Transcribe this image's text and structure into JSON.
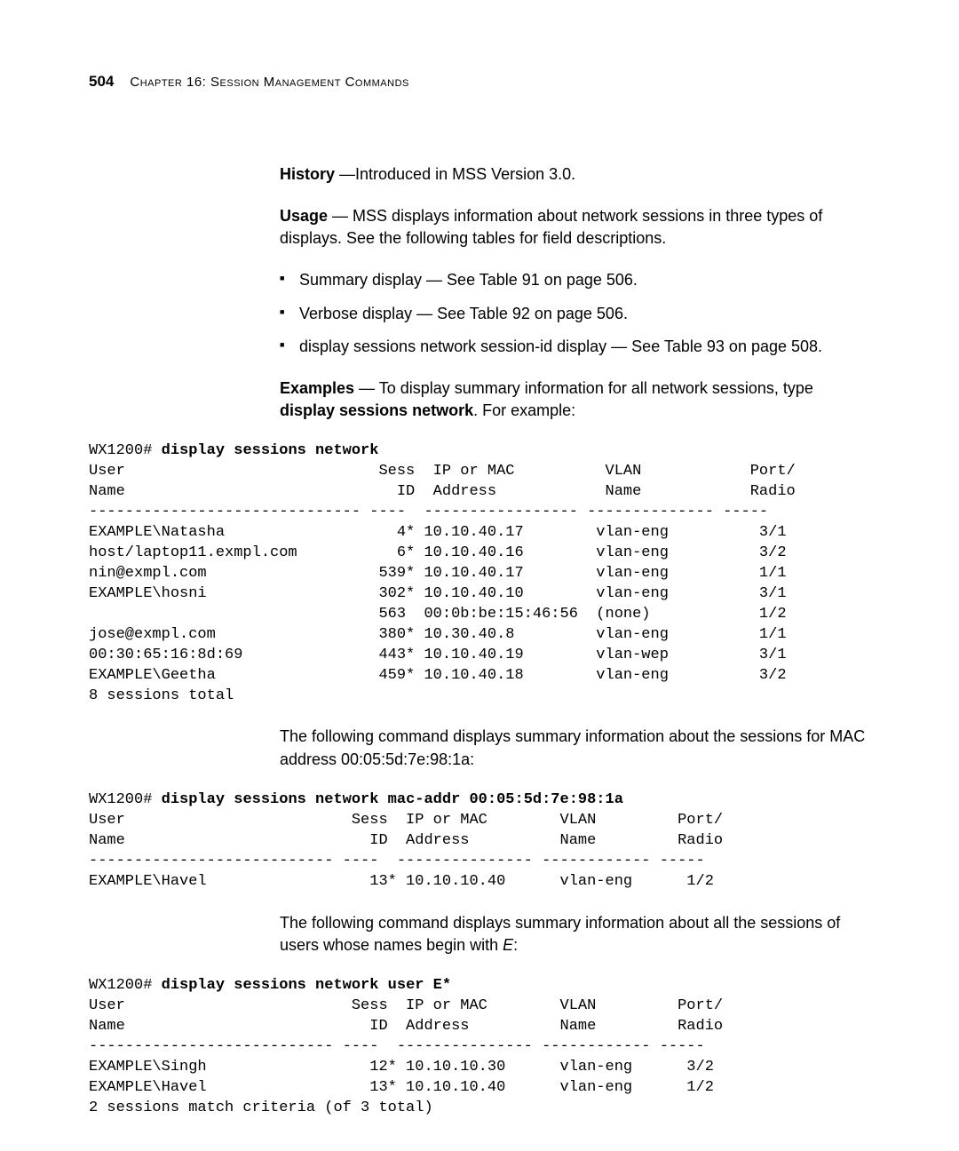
{
  "header": {
    "page_number": "504",
    "chapter_label": "Chapter 16: Session Management Commands"
  },
  "history": {
    "lead": "History",
    "text": " —Introduced in MSS Version 3.0."
  },
  "usage": {
    "lead": "Usage",
    "text": " — MSS displays information about network sessions in three types of displays. See the following tables for field descriptions."
  },
  "bullets": [
    {
      "bold": "Summary display",
      "rest": " — See Table 91 on page 506."
    },
    {
      "bold": "Verbose display",
      "rest": " — See Table 92 on page 506."
    },
    {
      "bold": "display sessions network session-id",
      "rest": " display — See Table 93 on page 508."
    }
  ],
  "examples": {
    "lead": "Examples",
    "text_before_cmd": " — To display summary information for all network sessions, type ",
    "cmd_bold": "display sessions network",
    "text_after_cmd": ". For example:"
  },
  "cli1": {
    "prompt": "WX1200# ",
    "command": "display sessions network",
    "header1": "User                            Sess  IP or MAC          VLAN            Port/",
    "header2": "Name                              ID  Address            Name            Radio",
    "divider": "------------------------------ ----  ----------------- -------------- -----",
    "rows": [
      "EXAMPLE\\Natasha                   4* 10.10.40.17        vlan-eng          3/1",
      "host/laptop11.exmpl.com           6* 10.10.40.16        vlan-eng          3/2",
      "nin@exmpl.com                   539* 10.10.40.17        vlan-eng          1/1",
      "EXAMPLE\\hosni                   302* 10.10.40.10        vlan-eng          3/1",
      "                                563  00:0b:be:15:46:56  (none)            1/2",
      "jose@exmpl.com                  380* 10.30.40.8         vlan-eng          1/1",
      "00:30:65:16:8d:69               443* 10.10.40.19        vlan-wep          3/1",
      "EXAMPLE\\Geetha                  459* 10.10.40.18        vlan-eng          3/2"
    ],
    "footer": "8 sessions total"
  },
  "para2": "The following command displays summary information about the sessions for MAC address 00:05:5d:7e:98:1a:",
  "cli2": {
    "prompt": "WX1200# ",
    "command": "display sessions network mac-addr 00:05:5d:7e:98:1a",
    "header1": "User                         Sess  IP or MAC        VLAN         Port/",
    "header2": "Name                           ID  Address          Name         Radio",
    "divider": "--------------------------- ----  --------------- ------------ -----",
    "rows": [
      "EXAMPLE\\Havel                  13* 10.10.10.40      vlan-eng      1/2"
    ]
  },
  "para3_before": "The following command displays summary information about all the sessions of users whose names begin with ",
  "para3_italic": "E",
  "para3_after": ":",
  "cli3": {
    "prompt": "WX1200# ",
    "command": "display sessions network user E*",
    "header1": "User                         Sess  IP or MAC        VLAN         Port/",
    "header2": "Name                           ID  Address          Name         Radio",
    "divider": "--------------------------- ----  --------------- ------------ -----",
    "rows": [
      "EXAMPLE\\Singh                  12* 10.10.10.30      vlan-eng      3/2",
      "EXAMPLE\\Havel                  13* 10.10.10.40      vlan-eng      1/2"
    ],
    "footer": "2 sessions match criteria (of 3 total)"
  }
}
